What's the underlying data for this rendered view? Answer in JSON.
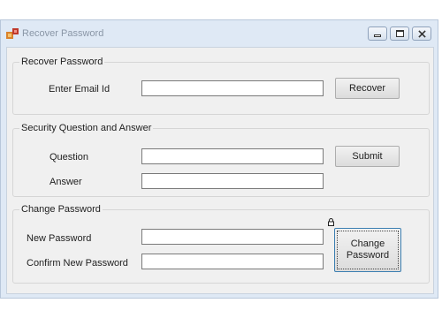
{
  "window": {
    "title": "Recover Password",
    "icons": [
      "app-icon",
      "minimize-icon",
      "maximize-icon",
      "close-icon"
    ]
  },
  "recover_group": {
    "legend": "Recover Password",
    "email_label": "Enter Email Id",
    "email_value": "",
    "recover_button": "Recover"
  },
  "security_group": {
    "legend": "Security Question and Answer",
    "question_label": "Question",
    "question_value": "",
    "answer_label": "Answer",
    "answer_value": "",
    "submit_button": "Submit"
  },
  "change_group": {
    "legend": "Change Password",
    "new_password_label": "New Password",
    "new_password_value": "",
    "confirm_password_label": "Confirm New Password",
    "confirm_password_value": "",
    "change_button": "Change\nPassword"
  },
  "colors": {
    "window_frame": "#dfe9f5",
    "form_background": "#f0f0f0",
    "title_text": "#8a96a6"
  }
}
